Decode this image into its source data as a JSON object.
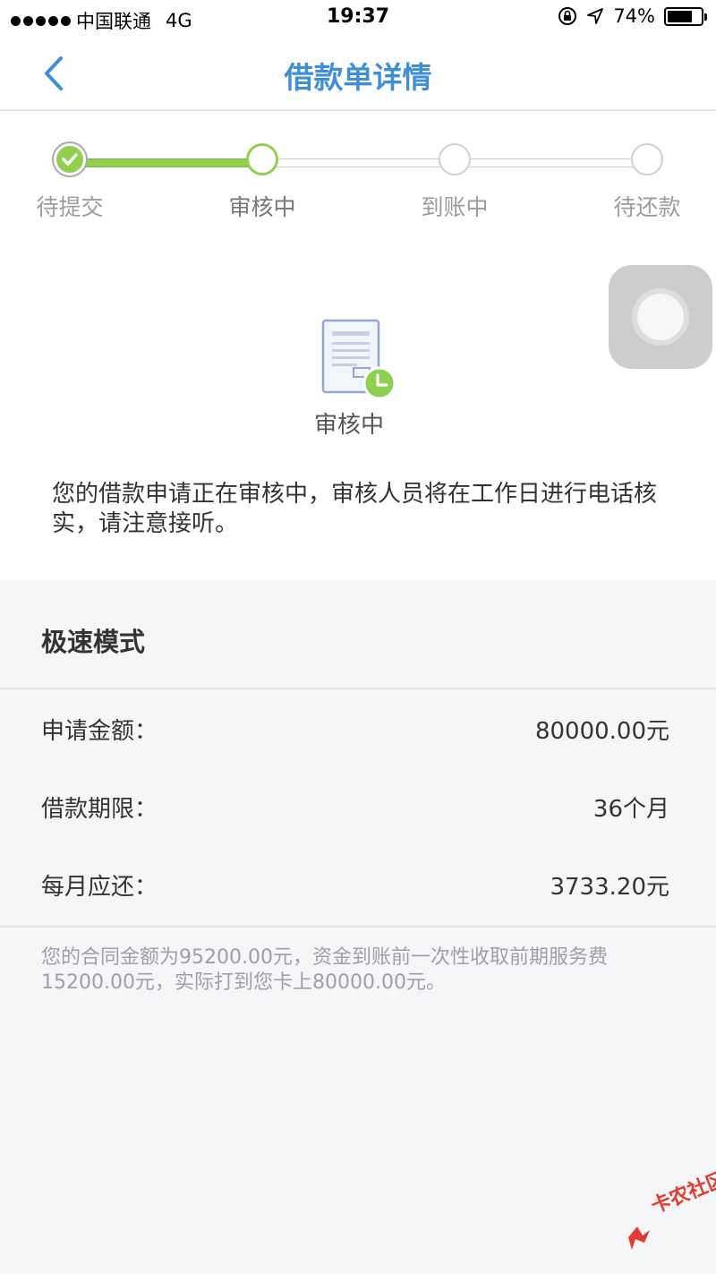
{
  "status_bar": {
    "carrier": "中国联通",
    "network": "4G",
    "time": "19:37",
    "battery": "74%",
    "battery_level": 0.74
  },
  "nav": {
    "title": "借款单详情"
  },
  "steps": [
    {
      "label": "待提交",
      "state": "completed"
    },
    {
      "label": "审核中",
      "state": "current"
    },
    {
      "label": "到账中",
      "state": "pending"
    },
    {
      "label": "待还款",
      "state": "pending"
    }
  ],
  "status": {
    "title": "审核中",
    "description": "您的借款申请正在审核中，审核人员将在工作日进行电话核实，请注意接听。"
  },
  "mode": {
    "title": "极速模式"
  },
  "details": [
    {
      "label": "申请金额：",
      "value": "80000.00元"
    },
    {
      "label": "借款期限：",
      "value": "36个月"
    },
    {
      "label": "每月应还：",
      "value": "3733.20元"
    }
  ],
  "notice": "您的合同金额为95200.00元，资金到账前一次性收取前期服务费15200.00元，实际打到您卡上80000.00元。",
  "watermark": "卡农社区",
  "colors": {
    "accent_blue": "#3e8fd8",
    "progress_green": "#8fd14f",
    "watermark_red": "#e33b2f"
  }
}
